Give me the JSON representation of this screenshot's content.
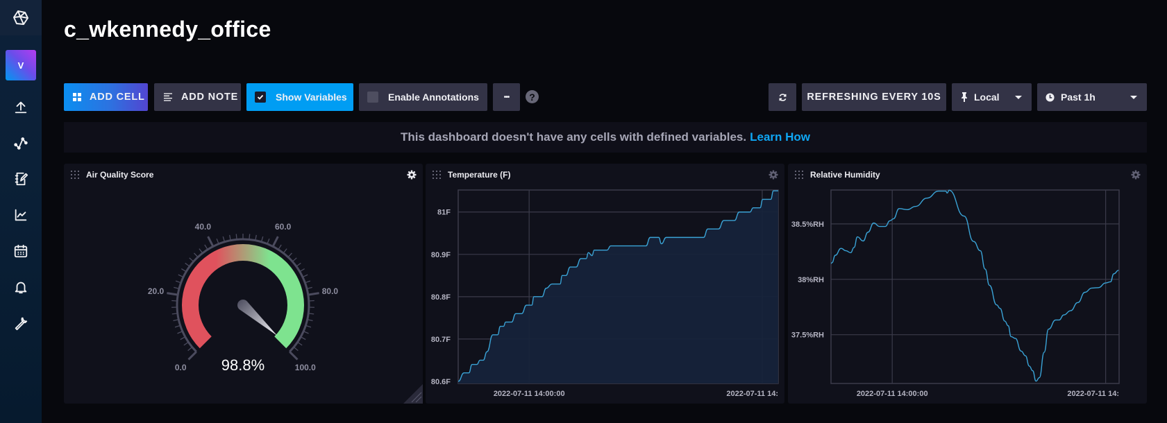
{
  "sidebar": {
    "logo": "cube-logo-icon",
    "avatar_letter": "V",
    "items": [
      {
        "name": "load-data",
        "icon": "upload-icon"
      },
      {
        "name": "data-explorer",
        "icon": "graph-nodes-icon"
      },
      {
        "name": "notebooks",
        "icon": "notebook-pencil-icon"
      },
      {
        "name": "dashboards",
        "icon": "line-chart-icon"
      },
      {
        "name": "tasks",
        "icon": "calendar-icon"
      },
      {
        "name": "alerts",
        "icon": "bell-icon"
      },
      {
        "name": "settings",
        "icon": "wrench-icon"
      }
    ]
  },
  "header": {
    "title": "c_wkennedy_office"
  },
  "toolbar": {
    "add_cell": "ADD CELL",
    "add_note": "ADD NOTE",
    "show_variables": "Show Variables",
    "show_variables_checked": true,
    "enable_annotations": "Enable Annotations",
    "enable_annotations_checked": false,
    "more": "•••",
    "help": "?",
    "refreshing": "REFRESHING EVERY 10S",
    "timezone": "Local",
    "time_range": "Past 1h"
  },
  "banner": {
    "message": "This dashboard doesn't have any cells with defined variables.",
    "link": "Learn How"
  },
  "cells": [
    {
      "title": "Air Quality Score"
    },
    {
      "title": "Temperature (F)"
    },
    {
      "title": "Relative Humidity"
    }
  ],
  "chart_data": [
    {
      "type": "gauge",
      "title": "Air Quality Score",
      "value": 98.8,
      "value_label": "98.8%",
      "min": 0,
      "max": 100,
      "tick_labels": [
        "0.0",
        "20.0",
        "40.0",
        "60.0",
        "80.0",
        "100.0"
      ],
      "colors": {
        "low": "#e0525d",
        "high": "#7ee38f"
      }
    },
    {
      "type": "area",
      "title": "Temperature (F)",
      "xlabel": "",
      "ylabel": "",
      "x_unit": "minutes into the past-1h window",
      "xlim": [
        0,
        60
      ],
      "ylim": [
        80.595,
        81.052
      ],
      "yticks": [
        80.6,
        80.7,
        80.8,
        80.9,
        81
      ],
      "ytick_labels": [
        "80.6F",
        "80.7F",
        "80.8F",
        "80.9F",
        "81F"
      ],
      "xticks": [
        13.3,
        57.0
      ],
      "xtick_labels": [
        "2022-07-11 14:00:00",
        "2022-07-11 14:"
      ],
      "grid": true,
      "color": "#3aa3d6",
      "series": [
        {
          "name": "temperature",
          "points": [
            [
              0,
              80.6
            ],
            [
              1.1,
              80.62
            ],
            [
              2.0,
              80.62
            ],
            [
              2.6,
              80.64
            ],
            [
              3.5,
              80.64
            ],
            [
              4.1,
              80.65
            ],
            [
              4.7,
              80.65
            ],
            [
              5.4,
              80.67
            ],
            [
              6.5,
              80.71
            ],
            [
              7.4,
              80.71
            ],
            [
              7.9,
              80.73
            ],
            [
              8.5,
              80.73
            ],
            [
              8.9,
              80.74
            ],
            [
              10.0,
              80.74
            ],
            [
              10.8,
              80.76
            ],
            [
              11.9,
              80.76
            ],
            [
              12.8,
              80.78
            ],
            [
              13.8,
              80.78
            ],
            [
              14.2,
              80.8
            ],
            [
              15.7,
              80.8
            ],
            [
              16.5,
              80.82
            ],
            [
              17.6,
              80.83
            ],
            [
              19.1,
              80.83
            ],
            [
              19.5,
              80.85
            ],
            [
              20.2,
              80.85
            ],
            [
              21.0,
              80.87
            ],
            [
              22.1,
              80.87
            ],
            [
              23.0,
              80.89
            ],
            [
              24.0,
              80.89
            ],
            [
              24.4,
              80.904
            ],
            [
              25.1,
              80.897
            ],
            [
              25.5,
              80.91
            ],
            [
              27.9,
              80.91
            ],
            [
              28.6,
              80.92
            ],
            [
              35.2,
              80.92
            ],
            [
              36.0,
              80.94
            ],
            [
              37.6,
              80.94
            ],
            [
              38.1,
              80.925
            ],
            [
              39.0,
              80.94
            ],
            [
              46.0,
              80.94
            ],
            [
              46.8,
              80.96
            ],
            [
              48.8,
              80.96
            ],
            [
              49.8,
              80.98
            ],
            [
              51.8,
              80.98
            ],
            [
              52.7,
              81.0
            ],
            [
              54.7,
              81.0
            ],
            [
              55.3,
              81.01
            ],
            [
              56.6,
              81.01
            ],
            [
              57.1,
              81.03
            ],
            [
              58.6,
              81.03
            ],
            [
              59.1,
              81.05
            ],
            [
              60,
              81.05
            ]
          ]
        }
      ]
    },
    {
      "type": "line",
      "title": "Relative Humidity",
      "xlabel": "",
      "ylabel": "",
      "x_unit": "minutes into the past-1h window",
      "xlim": [
        0,
        60
      ],
      "ylim": [
        37.06,
        38.806
      ],
      "yticks": [
        37.5,
        38,
        38.5
      ],
      "ytick_labels": [
        "37.5%RH",
        "38%RH",
        "38.5%RH"
      ],
      "xticks": [
        12.75,
        57.2
      ],
      "xtick_labels": [
        "2022-07-11 14:00:00",
        "2022-07-11 14:"
      ],
      "grid": true,
      "color": "#3aa3d6",
      "series": [
        {
          "name": "humidity",
          "points": [
            [
              0,
              38.144
            ],
            [
              0.2,
              38.15
            ],
            [
              0.9,
              38.217
            ],
            [
              2.1,
              38.279
            ],
            [
              3.1,
              38.258
            ],
            [
              4.1,
              38.24
            ],
            [
              4.8,
              38.288
            ],
            [
              5.5,
              38.383
            ],
            [
              6.7,
              38.346
            ],
            [
              7.7,
              38.425
            ],
            [
              8.9,
              38.508
            ],
            [
              10.1,
              38.477
            ],
            [
              11.3,
              38.477
            ],
            [
              12.3,
              38.529
            ],
            [
              13.0,
              38.546
            ],
            [
              14.2,
              38.638
            ],
            [
              15.9,
              38.629
            ],
            [
              17.6,
              38.658
            ],
            [
              20.0,
              38.733
            ],
            [
              22.4,
              38.796
            ],
            [
              23.9,
              38.796
            ],
            [
              24.2,
              38.779
            ],
            [
              24.6,
              38.804
            ],
            [
              27.7,
              38.571
            ],
            [
              29.7,
              38.342
            ],
            [
              31.1,
              38.258
            ],
            [
              32.1,
              38.092
            ],
            [
              33.0,
              37.946
            ],
            [
              34.5,
              37.769
            ],
            [
              35.2,
              37.738
            ],
            [
              36.2,
              37.623
            ],
            [
              36.9,
              37.581
            ],
            [
              37.5,
              37.483
            ],
            [
              38.4,
              37.467
            ],
            [
              39.6,
              37.352
            ],
            [
              40.5,
              37.31
            ],
            [
              41.3,
              37.217
            ],
            [
              42.0,
              37.175
            ],
            [
              42.7,
              37.081
            ],
            [
              43.4,
              37.113
            ],
            [
              44.4,
              37.342
            ],
            [
              45.3,
              37.55
            ],
            [
              46.8,
              37.633
            ],
            [
              47.5,
              37.633
            ],
            [
              48.5,
              37.679
            ],
            [
              49.9,
              37.717
            ],
            [
              51.4,
              37.79
            ],
            [
              52.9,
              37.883
            ],
            [
              54.3,
              37.921
            ],
            [
              55.7,
              37.925
            ],
            [
              57.2,
              37.967
            ],
            [
              58.2,
              37.977
            ],
            [
              58.9,
              38.05
            ],
            [
              59.9,
              38.081
            ]
          ]
        }
      ]
    }
  ]
}
